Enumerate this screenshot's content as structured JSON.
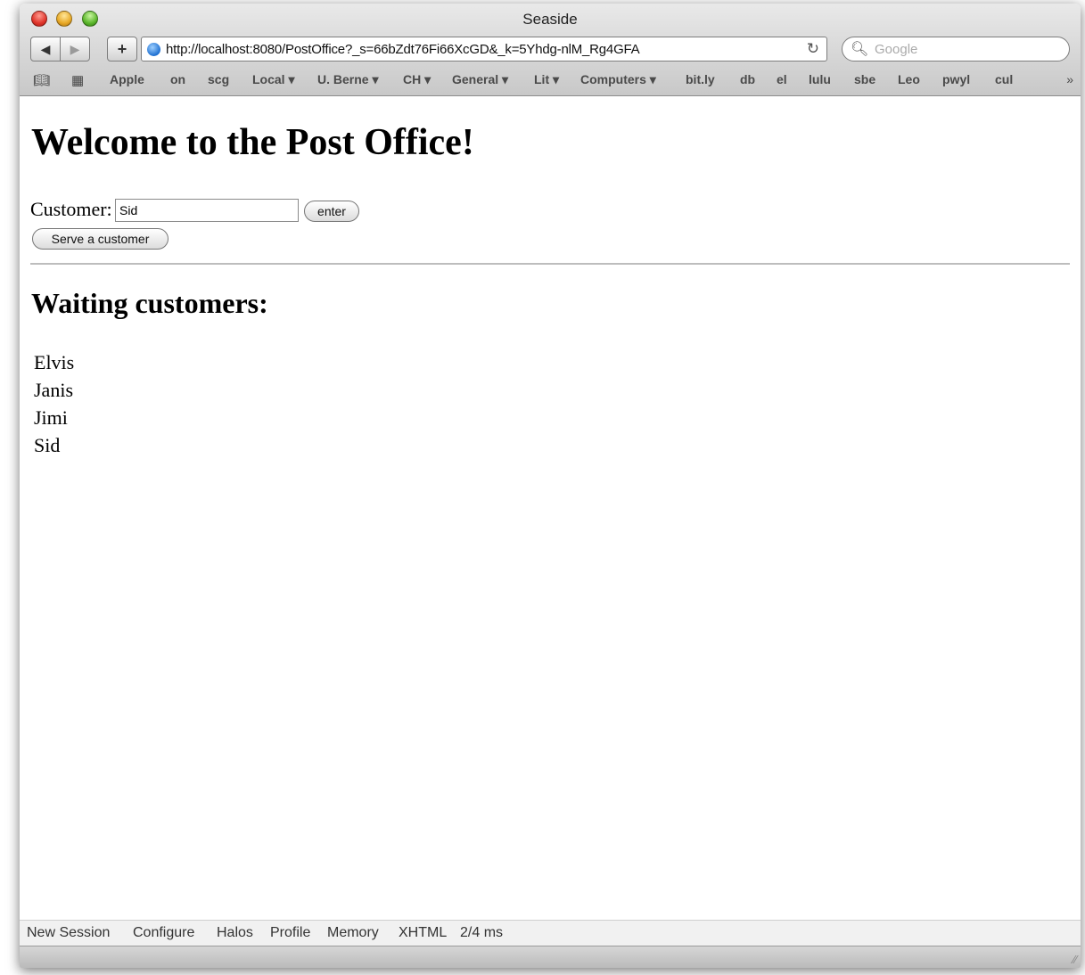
{
  "window": {
    "title": "Seaside"
  },
  "toolbar": {
    "back_icon": "back-arrow-icon",
    "forward_icon": "forward-arrow-icon",
    "add_icon": "plus-icon",
    "url": "http://localhost:8080/PostOffice?_s=66bZdt76Fi66XcGD&_k=5Yhdg-nlM_Rg4GFA",
    "search_placeholder": "Google"
  },
  "bookmarks": [
    "Apple",
    "on",
    "scg",
    "Local ▾",
    "U. Berne ▾",
    "CH ▾",
    "General ▾",
    "Lit ▾",
    "Computers ▾",
    "bit.ly",
    "db",
    "el",
    "lulu",
    "sbe",
    "Leo",
    "pwyl",
    "cul"
  ],
  "page": {
    "heading": "Welcome to the Post Office!",
    "customer_label": "Customer:",
    "customer_value": "Sid",
    "enter_label": "enter",
    "serve_label": "Serve a customer",
    "waiting_heading": "Waiting customers:",
    "customers": [
      "Elvis",
      "Janis",
      "Jimi",
      "Sid"
    ]
  },
  "footer": [
    "New Session",
    "Configure",
    "Halos",
    "Profile",
    "Memory",
    "XHTML",
    "2/4 ms"
  ],
  "colors": {
    "link_globe": "#1d6fd1",
    "close": "#e0352b",
    "minimize": "#e8a927",
    "zoom": "#5cb72c"
  }
}
